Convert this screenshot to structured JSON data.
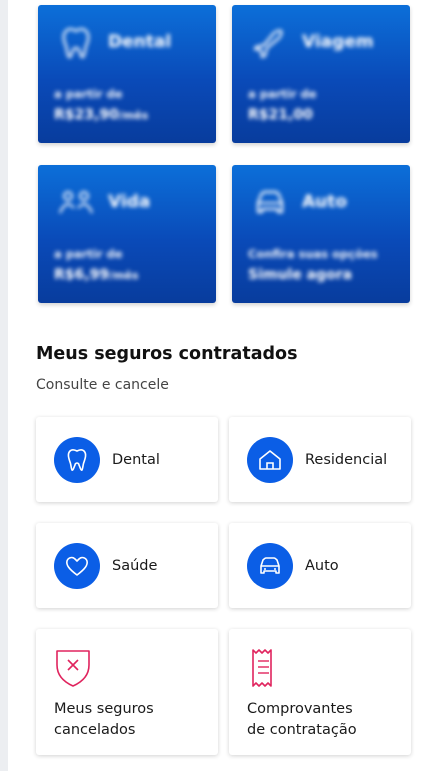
{
  "promos": [
    {
      "title": "Dental",
      "icon": "tooth-icon",
      "subtitle": "a partir de",
      "price": "R$23,90",
      "suffix": "/mês"
    },
    {
      "title": "Viagem",
      "icon": "airplane-icon",
      "subtitle": "a partir de",
      "price": "R$21,00",
      "suffix": ""
    },
    {
      "title": "Vida",
      "icon": "family-icon",
      "subtitle": "a partir de",
      "price": "R$6,99",
      "suffix": "/mês"
    },
    {
      "title": "Auto",
      "icon": "car-icon",
      "subtitle": "Confira suas opções",
      "price": "Simule agora",
      "suffix": ""
    }
  ],
  "section": {
    "title": "Meus seguros contratados",
    "subtitle": "Consulte e cancele"
  },
  "policies": [
    {
      "label": "Dental",
      "icon": "tooth-icon"
    },
    {
      "label": "Residencial",
      "icon": "house-icon"
    },
    {
      "label": "Saúde",
      "icon": "heart-icon"
    },
    {
      "label": "Auto",
      "icon": "car-icon"
    }
  ],
  "actions": [
    {
      "label": "Meus seguros\ncancelados",
      "icon": "shield-cancel-icon"
    },
    {
      "label": "Comprovantes\nde contratação",
      "icon": "receipt-icon"
    }
  ],
  "colors": {
    "brand_blue": "#0b5ee6",
    "promo_blue_dark": "#083c9d",
    "accent_red": "#e0245e"
  }
}
